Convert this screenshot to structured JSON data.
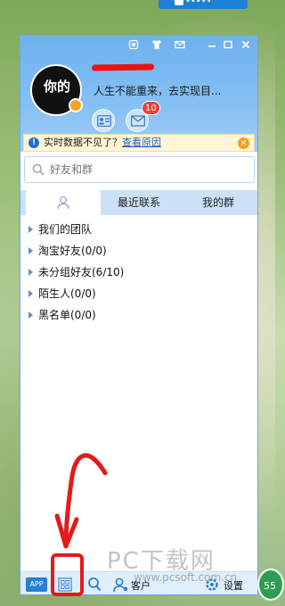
{
  "background": {
    "top_button_label": "•••••"
  },
  "window": {
    "controls": [
      "skin-icon",
      "shirt-icon",
      "mail-icon",
      "minimize-icon",
      "maximize-icon",
      "close-icon"
    ]
  },
  "profile": {
    "avatar_text": "你的",
    "signature": "人生不能重来，去实现目...",
    "mail_badge": "10"
  },
  "notice": {
    "text": "实时数据不见了？",
    "link": "查看原因"
  },
  "search": {
    "placeholder": "好友和群"
  },
  "tabs": [
    {
      "label": ""
    },
    {
      "label": "最近联系"
    },
    {
      "label": "我的群"
    }
  ],
  "groups": [
    {
      "label": "我们的团队"
    },
    {
      "label": "淘宝好友(0/0)"
    },
    {
      "label": "未分组好友(6/10)"
    },
    {
      "label": "陌生人(0/0)"
    },
    {
      "label": "黑名单(0/0)"
    }
  ],
  "footer": {
    "app": "APP",
    "customer": "客户",
    "settings": "设置"
  },
  "overlay": {
    "watermark_big": "PC下载网",
    "watermark_small": "www.pcsoft.com.cn",
    "bubble": "55"
  },
  "colors": {
    "header": "#6fb1ee",
    "accent": "#2a7ed4",
    "annotation": "#e31a1a",
    "badge": "#e8413a"
  }
}
